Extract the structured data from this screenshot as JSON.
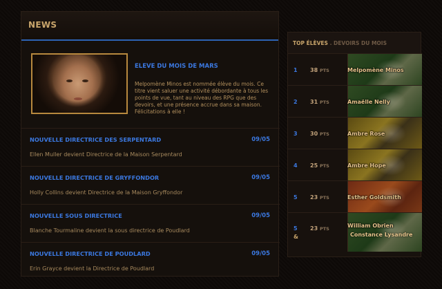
{
  "news": {
    "header": "NEWS",
    "feature": {
      "title": "ELEVE DU MOIS DE MARS",
      "text": "Melpomène Minos est nommée élève du mois. Ce titre vient saluer une activité débordante à tous les points de vue, tant au niveau des RPG que des devoirs, et une présence accrue dans sa maison. Félicitations à elle !"
    },
    "items": [
      {
        "title": "NOUVELLE DIRECTRICE DES SERPENTARD",
        "date": "09/05",
        "desc": "Ellen Muller devient Directrice de la Maison Serpentard"
      },
      {
        "title": "NOUVELLE DIRECTRICE DE GRYFFONDOR",
        "date": "09/05",
        "desc": "Holly Collins devient Directrice de la Maison Gryffondor"
      },
      {
        "title": "NOUVELLE SOUS DIRECTRICE",
        "date": "09/05",
        "desc": "Blanche Tourmaline devient la sous directrice de Poudlard"
      },
      {
        "title": "NOUVELLE DIRECTRICE DE POUDLARD",
        "date": "09/05",
        "desc": "Erin Grayce devient la Directrice de Poudlard"
      }
    ]
  },
  "top": {
    "title": "TOP ÉLÈVES",
    "subtitle": ". DEVOIRS DU MOIS",
    "pts_label": "PTS",
    "rows": [
      {
        "rank": "1",
        "points": "38",
        "name": "Melpomène Minos",
        "house": "slytherin"
      },
      {
        "rank": "2",
        "points": "31",
        "name": "Amaëlle Nelly",
        "house": "slytherin"
      },
      {
        "rank": "3",
        "points": "30",
        "name": "Ambre Rose",
        "house": "hufflepuff"
      },
      {
        "rank": "4",
        "points": "25",
        "name": "Ambre Hope",
        "house": "hufflepuff"
      },
      {
        "rank": "5",
        "points": "23",
        "name": "Esther Goldsmith",
        "house": "gryffindor"
      }
    ],
    "last": {
      "rank": "5",
      "rank_suffix": "&",
      "points": "23",
      "name1": "William Obrien",
      "name2": "Constance Lysandre",
      "house": "slytherin"
    }
  }
}
